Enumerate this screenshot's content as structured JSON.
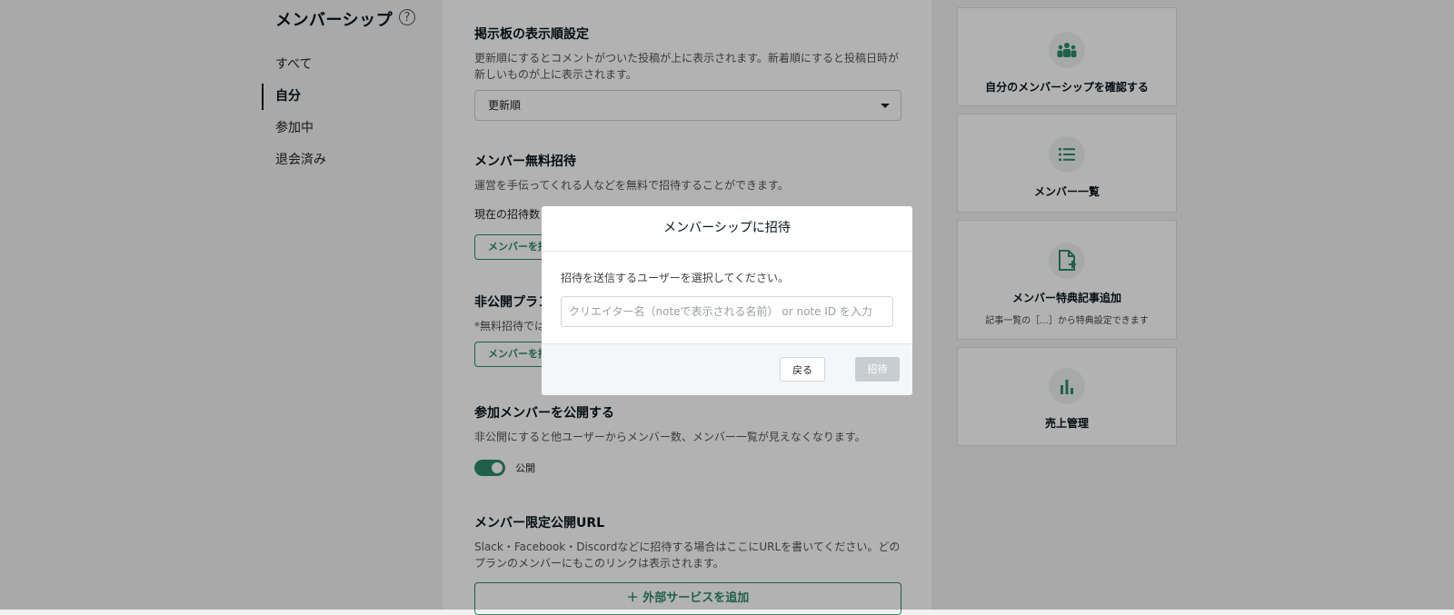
{
  "sidebar": {
    "title": "メンバーシップ",
    "help_glyph": "?",
    "items": [
      {
        "label": "すべて"
      },
      {
        "label": "自分"
      },
      {
        "label": "参加中"
      },
      {
        "label": "退会済み"
      }
    ],
    "active_index": 1
  },
  "main": {
    "board_order": {
      "heading": "掲示板の表示順設定",
      "desc": "更新順にするとコメントがついた投稿が上に表示されます。新着順にすると投稿日時が新しいものが上に表示されます。",
      "selected": "更新順"
    },
    "free_invite": {
      "heading": "メンバー無料招待",
      "desc": "運営を手伝ってくれる人などを無料で招待することができます。",
      "count_text": "現在の招待数",
      "button": "メンバーを招"
    },
    "private_plan": {
      "heading": "非公開プラン",
      "desc": "*無料招待では",
      "button": "メンバーを招"
    },
    "publish_members": {
      "heading": "参加メンバーを公開する",
      "desc": "非公開にすると他ユーザーからメンバー数、メンバー一覧が見えなくなります。",
      "toggle_label": "公開",
      "toggle_on": true
    },
    "limited_url": {
      "heading": "メンバー限定公開URL",
      "desc": "Slack・Facebook・Discordなどに招待する場合はここにURLを書いてください。どのプランのメンバーにもこのリンクは表示されます。",
      "add_button": "外部サービスを追加",
      "add_icon": "plus-icon"
    }
  },
  "cards": [
    {
      "icon": "group-icon",
      "title": "自分のメンバーシップを確認する",
      "sub": ""
    },
    {
      "icon": "list-icon",
      "title": "メンバー一覧",
      "sub": ""
    },
    {
      "icon": "file-plus-icon",
      "title": "メンバー特典記事追加",
      "sub": "記事一覧の［...］から特典設定できます"
    },
    {
      "icon": "bar-chart-icon",
      "title": "売上管理",
      "sub": ""
    }
  ],
  "modal": {
    "title": "メンバーシップに招待",
    "desc": "招待を送信するユーザーを選択してください。",
    "input_placeholder": "クリエイター名（noteで表示される名前） or note ID を入力",
    "input_value": "",
    "back_button": "戻る",
    "invite_button": "招待",
    "invite_enabled": false
  },
  "colors": {
    "accent": "#2f8a6a",
    "overlay": "rgba(0,0,0,0.30)",
    "disabled_button": "#c8cdd1"
  }
}
